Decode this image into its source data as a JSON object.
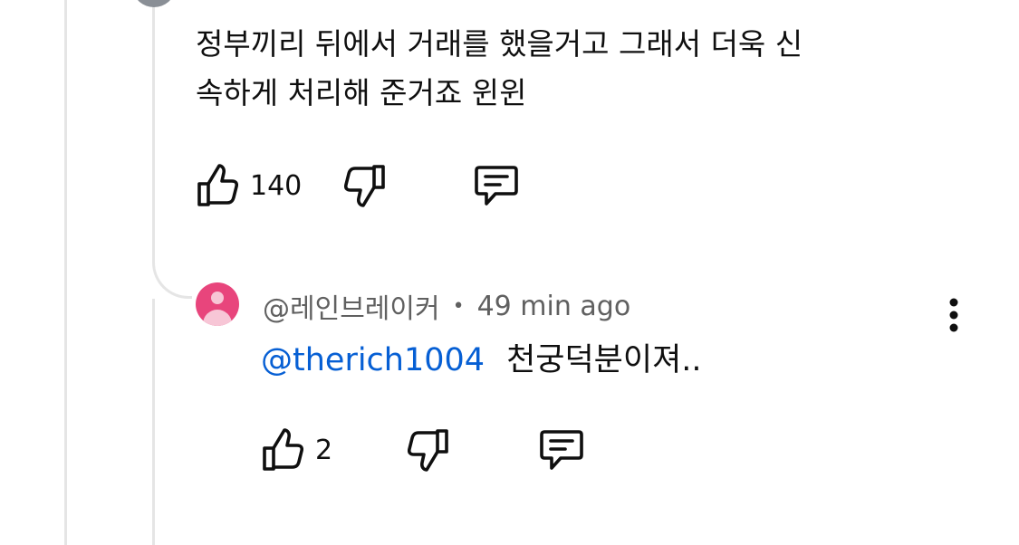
{
  "comment": {
    "text_line1": "정부끼리 뒤에서 거래를 했을거고 그래서 더욱 신",
    "text_line2": "속하게 처리해 준거죠 윈윈",
    "like_count": "140"
  },
  "reply": {
    "author": "@레인브레이커",
    "separator": "•",
    "time": "49 min ago",
    "mention": "@therich1004",
    "text": "천궁덕분이져..",
    "like_count": "2"
  },
  "colors": {
    "mention": "#065fd4",
    "avatar": "#e8457c",
    "thread_line": "#e5e5e5",
    "meta_text": "#606060"
  },
  "icons": [
    "like-icon",
    "dislike-icon",
    "reply-icon",
    "more-vert-icon"
  ]
}
